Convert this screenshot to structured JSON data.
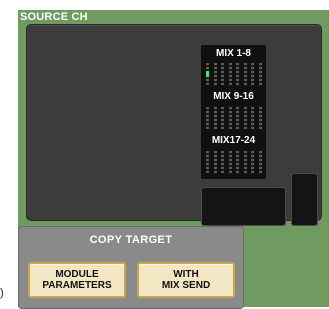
{
  "source_channel": {
    "title": "SOURCE CH",
    "mix_groups": [
      {
        "label": "MIX 1-8",
        "channel_count": 8,
        "active_channel": 1
      },
      {
        "label": "MIX 9-16",
        "channel_count": 8
      },
      {
        "label": "MIX17-24",
        "channel_count": 8
      }
    ]
  },
  "copy_target": {
    "title": "COPY TARGET",
    "buttons": [
      {
        "label": "MODULE\nPARAMETERS"
      },
      {
        "label": "WITH\nMIX SEND"
      }
    ]
  },
  "edge_mark": ")",
  "colors": {
    "frame_green": "#6f9a60",
    "panel_dark": "#3c3c3c",
    "button_fill": "#f3e6c2",
    "button_border": "#c7a84f",
    "active_indicator": "#4ee07a"
  }
}
